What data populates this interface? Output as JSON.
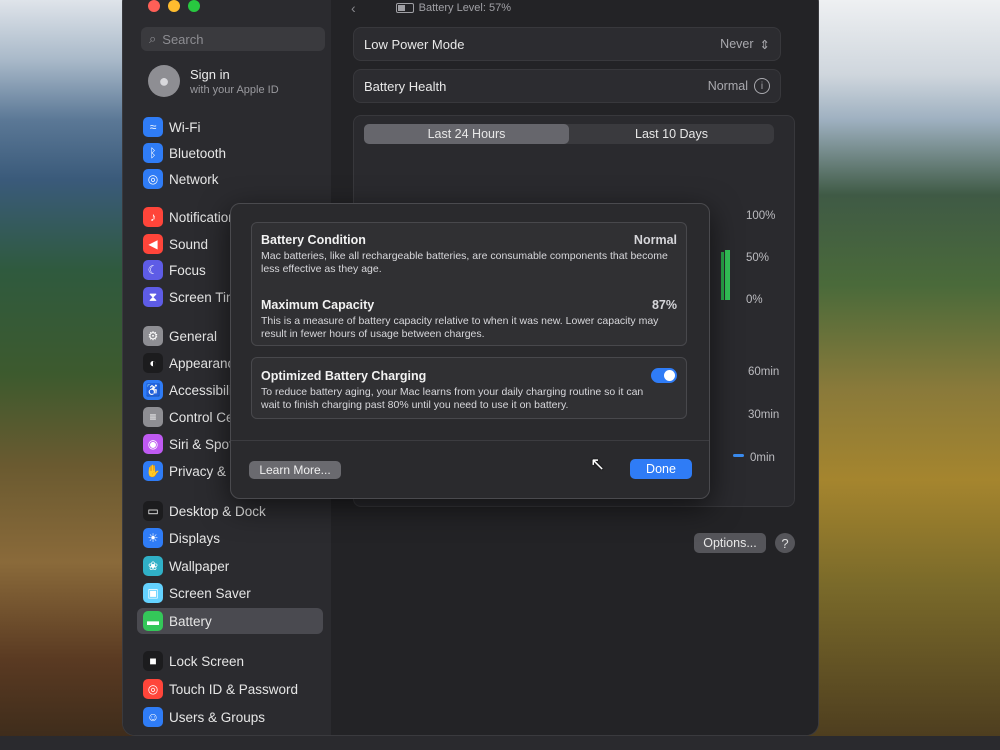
{
  "header": {
    "battery_level": "Battery Level: 57%"
  },
  "sidebar": {
    "search_placeholder": "Search",
    "signin_title": "Sign in",
    "signin_subtitle": "with your Apple ID",
    "items": [
      {
        "label": "Wi-Fi",
        "icon": "wifi-icon",
        "color": "#2f7cf6"
      },
      {
        "label": "Bluetooth",
        "icon": "bluetooth-icon",
        "color": "#2f7cf6"
      },
      {
        "label": "Network",
        "icon": "globe-icon",
        "color": "#2f7cf6"
      },
      {
        "label": "Notifications",
        "icon": "bell-icon",
        "color": "#ff453a"
      },
      {
        "label": "Sound",
        "icon": "speaker-icon",
        "color": "#ff453a"
      },
      {
        "label": "Focus",
        "icon": "moon-icon",
        "color": "#5e5ce6"
      },
      {
        "label": "Screen Time",
        "icon": "hourglass-icon",
        "color": "#5e5ce6"
      },
      {
        "label": "General",
        "icon": "gear-icon",
        "color": "#8e8e93"
      },
      {
        "label": "Appearance",
        "icon": "appearance-icon",
        "color": "#1c1c1e"
      },
      {
        "label": "Accessibility",
        "icon": "accessibility-icon",
        "color": "#2f7cf6"
      },
      {
        "label": "Control Centre",
        "icon": "control-centre-icon",
        "color": "#8e8e93"
      },
      {
        "label": "Siri & Spotlight",
        "icon": "siri-icon",
        "color": "#bf5af2"
      },
      {
        "label": "Privacy & Security",
        "icon": "hand-icon",
        "color": "#2f7cf6"
      },
      {
        "label": "Desktop & Dock",
        "icon": "dock-icon",
        "color": "#1c1c1e"
      },
      {
        "label": "Displays",
        "icon": "sun-icon",
        "color": "#2f7cf6"
      },
      {
        "label": "Wallpaper",
        "icon": "wallpaper-icon",
        "color": "#30b0c7"
      },
      {
        "label": "Screen Saver",
        "icon": "screensaver-icon",
        "color": "#64d2ff"
      },
      {
        "label": "Battery",
        "icon": "battery-icon",
        "color": "#34c759"
      },
      {
        "label": "Lock Screen",
        "icon": "lock-icon",
        "color": "#1c1c1e"
      },
      {
        "label": "Touch ID & Password",
        "icon": "fingerprint-icon",
        "color": "#ff453a"
      },
      {
        "label": "Users & Groups",
        "icon": "users-icon",
        "color": "#2f7cf6"
      }
    ],
    "active_item": "Battery"
  },
  "battery_settings": {
    "low_power_label": "Low Power Mode",
    "low_power_value": "Never",
    "health_label": "Battery Health",
    "health_value": "Normal",
    "tabs": [
      "Last 24 Hours",
      "Last 10 Days"
    ],
    "selected_tab": "Last 24 Hours",
    "chart_labels_level": [
      "100%",
      "50%",
      "0%"
    ],
    "chart_labels_usage": [
      "60min",
      "30min",
      "0min"
    ],
    "options_label": "Options...",
    "help_label": "?"
  },
  "dialog": {
    "condition_title": "Battery Condition",
    "condition_value": "Normal",
    "condition_desc": "Mac batteries, like all rechargeable batteries, are consumable components that become less effective as they age.",
    "capacity_title": "Maximum Capacity",
    "capacity_value": "87%",
    "capacity_desc": "This is a measure of battery capacity relative to when it was new. Lower capacity may result in fewer hours of usage between charges.",
    "optimized_title": "Optimized Battery Charging",
    "optimized_desc": "To reduce battery aging, your Mac learns from your daily charging routine so it can wait to finish charging past 80% until you need to use it on battery.",
    "optimized_enabled": true,
    "learn_more": "Learn More...",
    "done": "Done"
  }
}
